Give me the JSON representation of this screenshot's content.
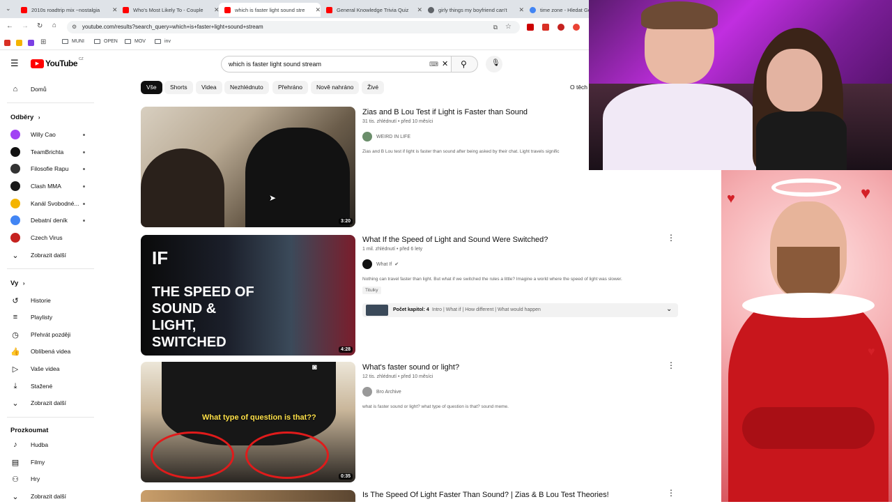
{
  "browser": {
    "tabs": [
      {
        "title": "2010s roadtrip mix ~nostalgia",
        "favicon_color": "#ff0000"
      },
      {
        "title": "Who's Most Likely To - Couple",
        "favicon_color": "#ff0000"
      },
      {
        "title": "which is faster light sound stre",
        "favicon_color": "#ff0000"
      },
      {
        "title": "General Knowledge Trivia Quiz",
        "favicon_color": "#ff0000"
      },
      {
        "title": "girly things my boyfriend can't",
        "favicon_color": "#5f6368"
      },
      {
        "title": "time zone - Hledat Go",
        "favicon_color": "#4285f4"
      }
    ],
    "url": "youtube.com/results?search_query=which+is+faster+light+sound+stream",
    "bookmarks": [
      "MUNI",
      "OPEN",
      "MOV",
      "inv"
    ]
  },
  "youtube": {
    "logo_text": "YouTube",
    "logo_region": "CZ",
    "search_value": "which is faster light sound stream",
    "chips": [
      "Vše",
      "Shorts",
      "Videa",
      "Nezhlédnuto",
      "Přehráno",
      "Nově nahráno",
      "Živé"
    ],
    "filters_label": "O těch"
  },
  "sidebar": {
    "home": "Domů",
    "subscriptions_heading": "Odběry",
    "subscriptions": [
      {
        "name": "Willy Cao",
        "color": "#a142f4"
      },
      {
        "name": "TeamBrichta",
        "color": "#111111"
      },
      {
        "name": "Filosofie Rapu",
        "color": "#333333"
      },
      {
        "name": "Clash MMA",
        "color": "#1a1a1a"
      },
      {
        "name": "Kanál Svobodné...",
        "color": "#f4b400"
      },
      {
        "name": "Debatní deník",
        "color": "#4285f4"
      },
      {
        "name": "Czech Virus",
        "color": "#c5221f"
      }
    ],
    "show_more_subs": "Zobrazit další",
    "you_heading": "Vy",
    "you_items": [
      "Historie",
      "Playlisty",
      "Přehrát později",
      "Oblíbená videa",
      "Vaše videa",
      "Stažené"
    ],
    "show_more_you": "Zobrazit další",
    "explore_heading": "Prozkoumat",
    "explore_items": [
      "Hudba",
      "Filmy",
      "Hry"
    ],
    "show_more_explore": "Zobrazit další"
  },
  "results": [
    {
      "title": "Zias and B Lou Test if Light is Faster than Sound",
      "meta": "31 tis. zhlédnutí • před 10 měsíci",
      "channel": "WEIRD IN LIFE",
      "desc": "Zias and B Lou test if light is faster than sound after being asked by their chat. Light travels signific",
      "duration": "3:20"
    },
    {
      "title": "What If the Speed of Light and Sound Were Switched?",
      "meta": "1 mil. zhlédnutí • před 6 lety",
      "channel": "What If",
      "desc": "Nothing can travel faster than light. But what if we switched the rules a little? Imagine a world where the speed of light was slower.",
      "badge": "Titulky",
      "chapters": "Počet kapitol: 4",
      "chapters_list": "Intro | What if | How different | What would happen",
      "thumb_text": "THE SPEED OF SOUND & LIGHT, SWITCHED",
      "duration": "4:28"
    },
    {
      "title": "What's faster sound or light?",
      "meta": "12 tis. zhlédnutí • před 10 měsíci",
      "channel": "Bro Archive",
      "desc": "what is faster sound or light? what type of question is that? sound meme.",
      "thumb_text": "What type of question is that??",
      "duration": "0:35"
    },
    {
      "title": "Is The Speed Of Light Faster Than Sound? | Zias & B Lou Test Theories!"
    }
  ]
}
